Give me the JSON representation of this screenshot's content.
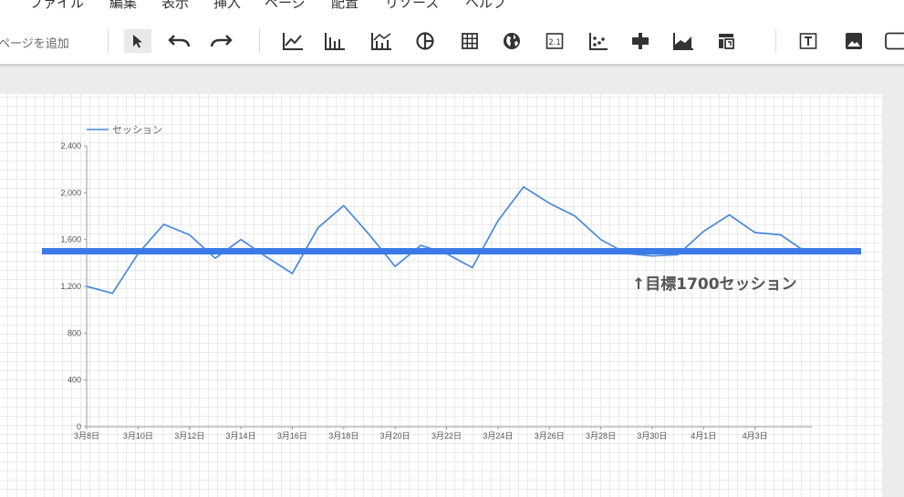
{
  "menubar": {
    "items": [
      {
        "label": "ファイル"
      },
      {
        "label": "編集"
      },
      {
        "label": "表示"
      },
      {
        "label": "挿入"
      },
      {
        "label": "ページ"
      },
      {
        "label": "配置"
      },
      {
        "label": "リソース"
      },
      {
        "label": "ヘルプ"
      }
    ]
  },
  "toolbar": {
    "add_page_label": "ページを追加",
    "tools": [
      "select-icon",
      "undo-icon",
      "redo-icon",
      "time-series-chart-icon",
      "bar-chart-icon",
      "combo-chart-icon",
      "pie-chart-icon",
      "table-icon",
      "geo-map-icon",
      "scorecard-icon",
      "scatter-chart-icon",
      "bullet-chart-icon",
      "area-chart-icon",
      "pivot-table-icon",
      "text-icon",
      "image-icon",
      "rectangle-icon"
    ],
    "scorecard_text": "2.1"
  },
  "chart_data": {
    "type": "line",
    "series": [
      {
        "name": "セッション",
        "color": "#4a89dc",
        "values": [
          1200,
          1140,
          1480,
          1730,
          1640,
          1440,
          1600,
          1450,
          1310,
          1700,
          1890,
          1640,
          1370,
          1550,
          1480,
          1360,
          1760,
          2050,
          1910,
          1800,
          1600,
          1480,
          1460,
          1470,
          1670,
          1810,
          1660,
          1640,
          1490
        ]
      }
    ],
    "x_tick_labels": [
      "3月8日",
      "3月10日",
      "3月12日",
      "3月14日",
      "3月16日",
      "3月18日",
      "3月20日",
      "3月22日",
      "3月24日",
      "3月26日",
      "3月28日",
      "3月30日",
      "4月1日",
      "4月3日"
    ],
    "y_tick_labels": [
      "0",
      "400",
      "800",
      "1,200",
      "1,600",
      "2,000",
      "2,400"
    ],
    "y_ticks": [
      0,
      400,
      800,
      1200,
      1600,
      2000,
      2400
    ],
    "ylim": [
      0,
      2400
    ],
    "grid": false,
    "legend_position": "top-left",
    "reference_line": {
      "value": 1500,
      "color": "#3b7ae6"
    },
    "annotation": "↑目標1700セッション"
  }
}
